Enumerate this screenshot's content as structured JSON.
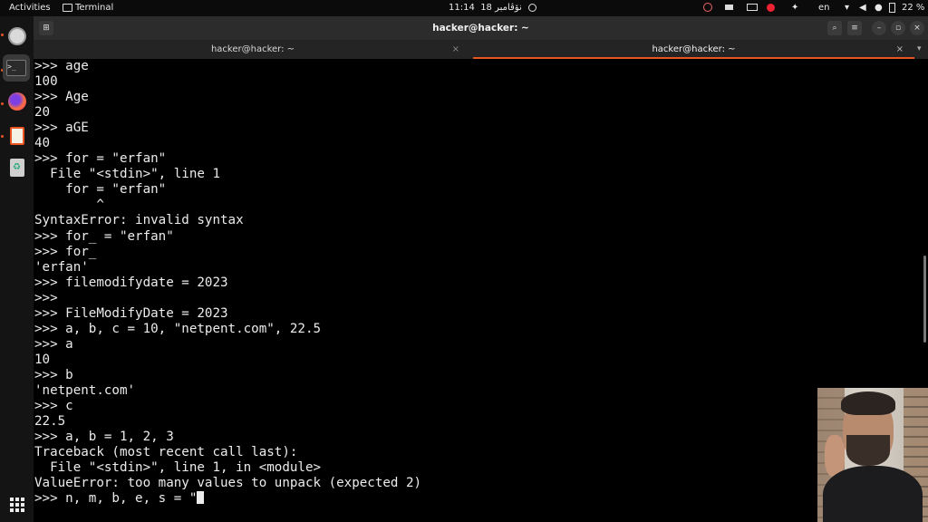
{
  "topbar": {
    "activities": "Activities",
    "app_name": "Terminal",
    "clock_time": "11:14",
    "clock_date": "18 نۆڤامبر",
    "language": "en",
    "battery": "22 %"
  },
  "window": {
    "title": "hacker@hacker: ~",
    "tabs": [
      {
        "label": "hacker@hacker: ~"
      },
      {
        "label": "hacker@hacker: ~"
      }
    ]
  },
  "terminal": {
    "lines": [
      ">>> age",
      "100",
      ">>> Age",
      "20",
      ">>> aGE",
      "40",
      ">>> for = \"erfan\"",
      "  File \"<stdin>\", line 1",
      "    for = \"erfan\"",
      "        ^",
      "SyntaxError: invalid syntax",
      ">>> for_ = \"erfan\"",
      ">>> for_",
      "'erfan'",
      ">>> filemodifydate = 2023",
      ">>>",
      ">>> FileModifyDate = 2023",
      ">>> a, b, c = 10, \"netpent.com\", 22.5",
      ">>> a",
      "10",
      ">>> b",
      "'netpent.com'",
      ">>> c",
      "22.5",
      ">>> a, b = 1, 2, 3",
      "Traceback (most recent call last):",
      "  File \"<stdin>\", line 1, in <module>",
      "ValueError: too many values to unpack (expected 2)",
      ">>> n, m, b, e, s = \""
    ]
  },
  "colors": {
    "accent": "#e95420",
    "terminal_bg": "#000000",
    "header_bg": "#2c2c2c"
  },
  "icons": [
    "apps-grid-icon",
    "terminal-icon",
    "firefox-icon",
    "text-editor-icon",
    "trash-icon",
    "wifi-icon",
    "volume-icon",
    "mic-icon",
    "battery-icon"
  ]
}
